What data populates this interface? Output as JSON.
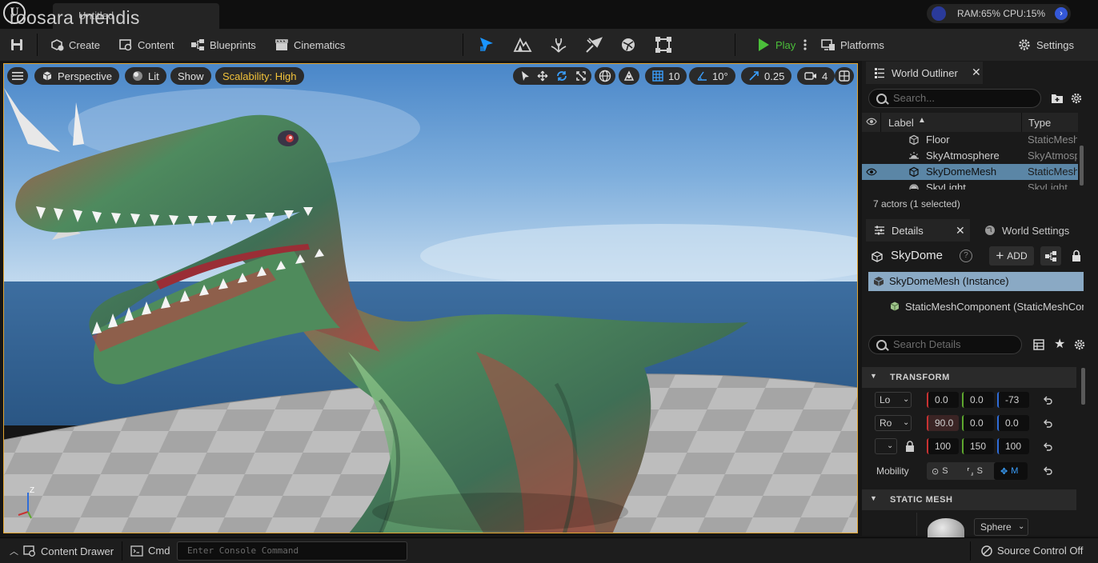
{
  "window": {
    "document_tab": "Untitled",
    "watermark": "roosara mendis",
    "perf_text": "RAM:65%  CPU:15%"
  },
  "toolbar": {
    "save_icon": "save-icon",
    "create_label": "Create",
    "content_label": "Content",
    "blueprints_label": "Blueprints",
    "cinematics_label": "Cinematics",
    "play_label": "Play",
    "platforms_label": "Platforms",
    "settings_label": "Settings"
  },
  "viewport": {
    "perspective_label": "Perspective",
    "lit_label": "Lit",
    "show_label": "Show",
    "scalability_label": "Scalability: High",
    "grid_snap": "10",
    "rotation_snap": "10°",
    "scale_snap": "0.25",
    "camera_speed": "4",
    "axis_z": "Z",
    "scalability_color": "#f2c23a"
  },
  "outliner": {
    "tab_label": "World Outliner",
    "search_placeholder": "Search...",
    "col_label": "Label",
    "col_type": "Type",
    "rows": [
      {
        "label": "Floor",
        "type": "StaticMesh"
      },
      {
        "label": "SkyAtmosphere",
        "type": "SkyAtmosphere"
      },
      {
        "label": "SkyDomeMesh",
        "type": "StaticMesh"
      },
      {
        "label": "SkyLight",
        "type": "SkyLight"
      }
    ],
    "status": "7 actors (1 selected)"
  },
  "details": {
    "tab_label": "Details",
    "world_settings_label": "World Settings",
    "actor_name": "SkyDome",
    "add_label": "ADD",
    "instance_label": "SkyDomeMesh (Instance)",
    "component_label": "StaticMeshComponent (StaticMeshComponent)",
    "search_placeholder": "Search Details",
    "transform_header": "TRANSFORM",
    "location_label": "Lo",
    "rotation_label": "Ro",
    "location": [
      "0.0",
      "0.0",
      "-73"
    ],
    "rotation": [
      "90.0",
      "0.0",
      "0.0"
    ],
    "scale": [
      "100",
      "150",
      "100"
    ],
    "mobility_label": "Mobility",
    "mobility_options": [
      "S",
      "S",
      "M"
    ],
    "static_mesh_header": "STATIC MESH",
    "mesh_value": "Sphere"
  },
  "statusbar": {
    "content_drawer_label": "Content Drawer",
    "cmd_label": "Cmd",
    "console_placeholder": "Enter Console Command",
    "source_control_label": "Source Control Off"
  }
}
